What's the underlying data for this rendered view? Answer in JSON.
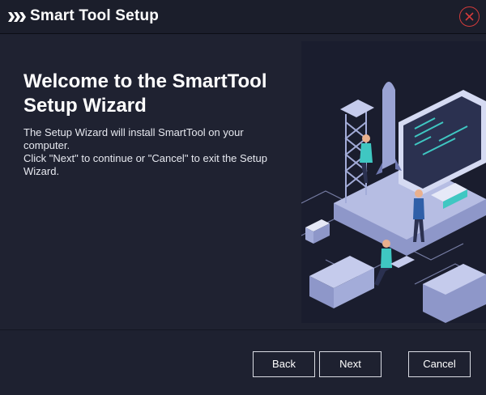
{
  "window": {
    "title": "Smart Tool Setup",
    "close_icon": "close-icon"
  },
  "welcome": {
    "heading": "Welcome to the SmartTool Setup Wizard",
    "line1": "The Setup Wizard will install SmartTool on your computer.",
    "line2": "Click \"Next\" to continue or \"Cancel\" to exit the Setup Wizard."
  },
  "buttons": {
    "back": "Back",
    "next": "Next",
    "cancel": "Cancel"
  },
  "colors": {
    "background": "#1e2130",
    "close_accent": "#d23b3b",
    "illustration_accent": "#3fc7c2"
  }
}
